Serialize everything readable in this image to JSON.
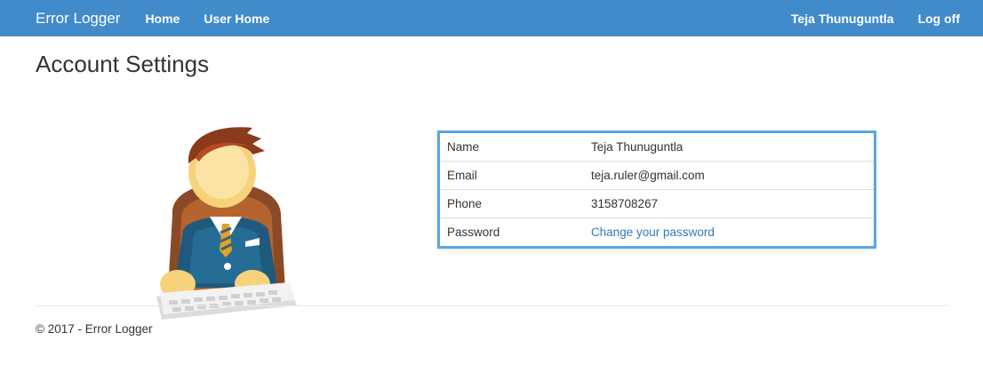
{
  "navbar": {
    "brand": "Error Logger",
    "links": [
      "Home",
      "User Home"
    ],
    "user_name": "Teja Thunuguntla",
    "logoff": "Log off",
    "bg_color": "#428bca"
  },
  "page": {
    "title": "Account Settings"
  },
  "avatar": {
    "icon": "businessman-at-keyboard-avatar"
  },
  "account": {
    "rows": [
      {
        "label": "Name",
        "value": "Teja Thunuguntla"
      },
      {
        "label": "Email",
        "value": "teja.ruler@gmail.com"
      },
      {
        "label": "Phone",
        "value": "3158708267"
      },
      {
        "label": "Password",
        "value": "Change your password"
      }
    ],
    "border_color": "#5aa6e6",
    "link_color": "#337ab7"
  },
  "footer": {
    "text": "© 2017 - Error Logger"
  }
}
